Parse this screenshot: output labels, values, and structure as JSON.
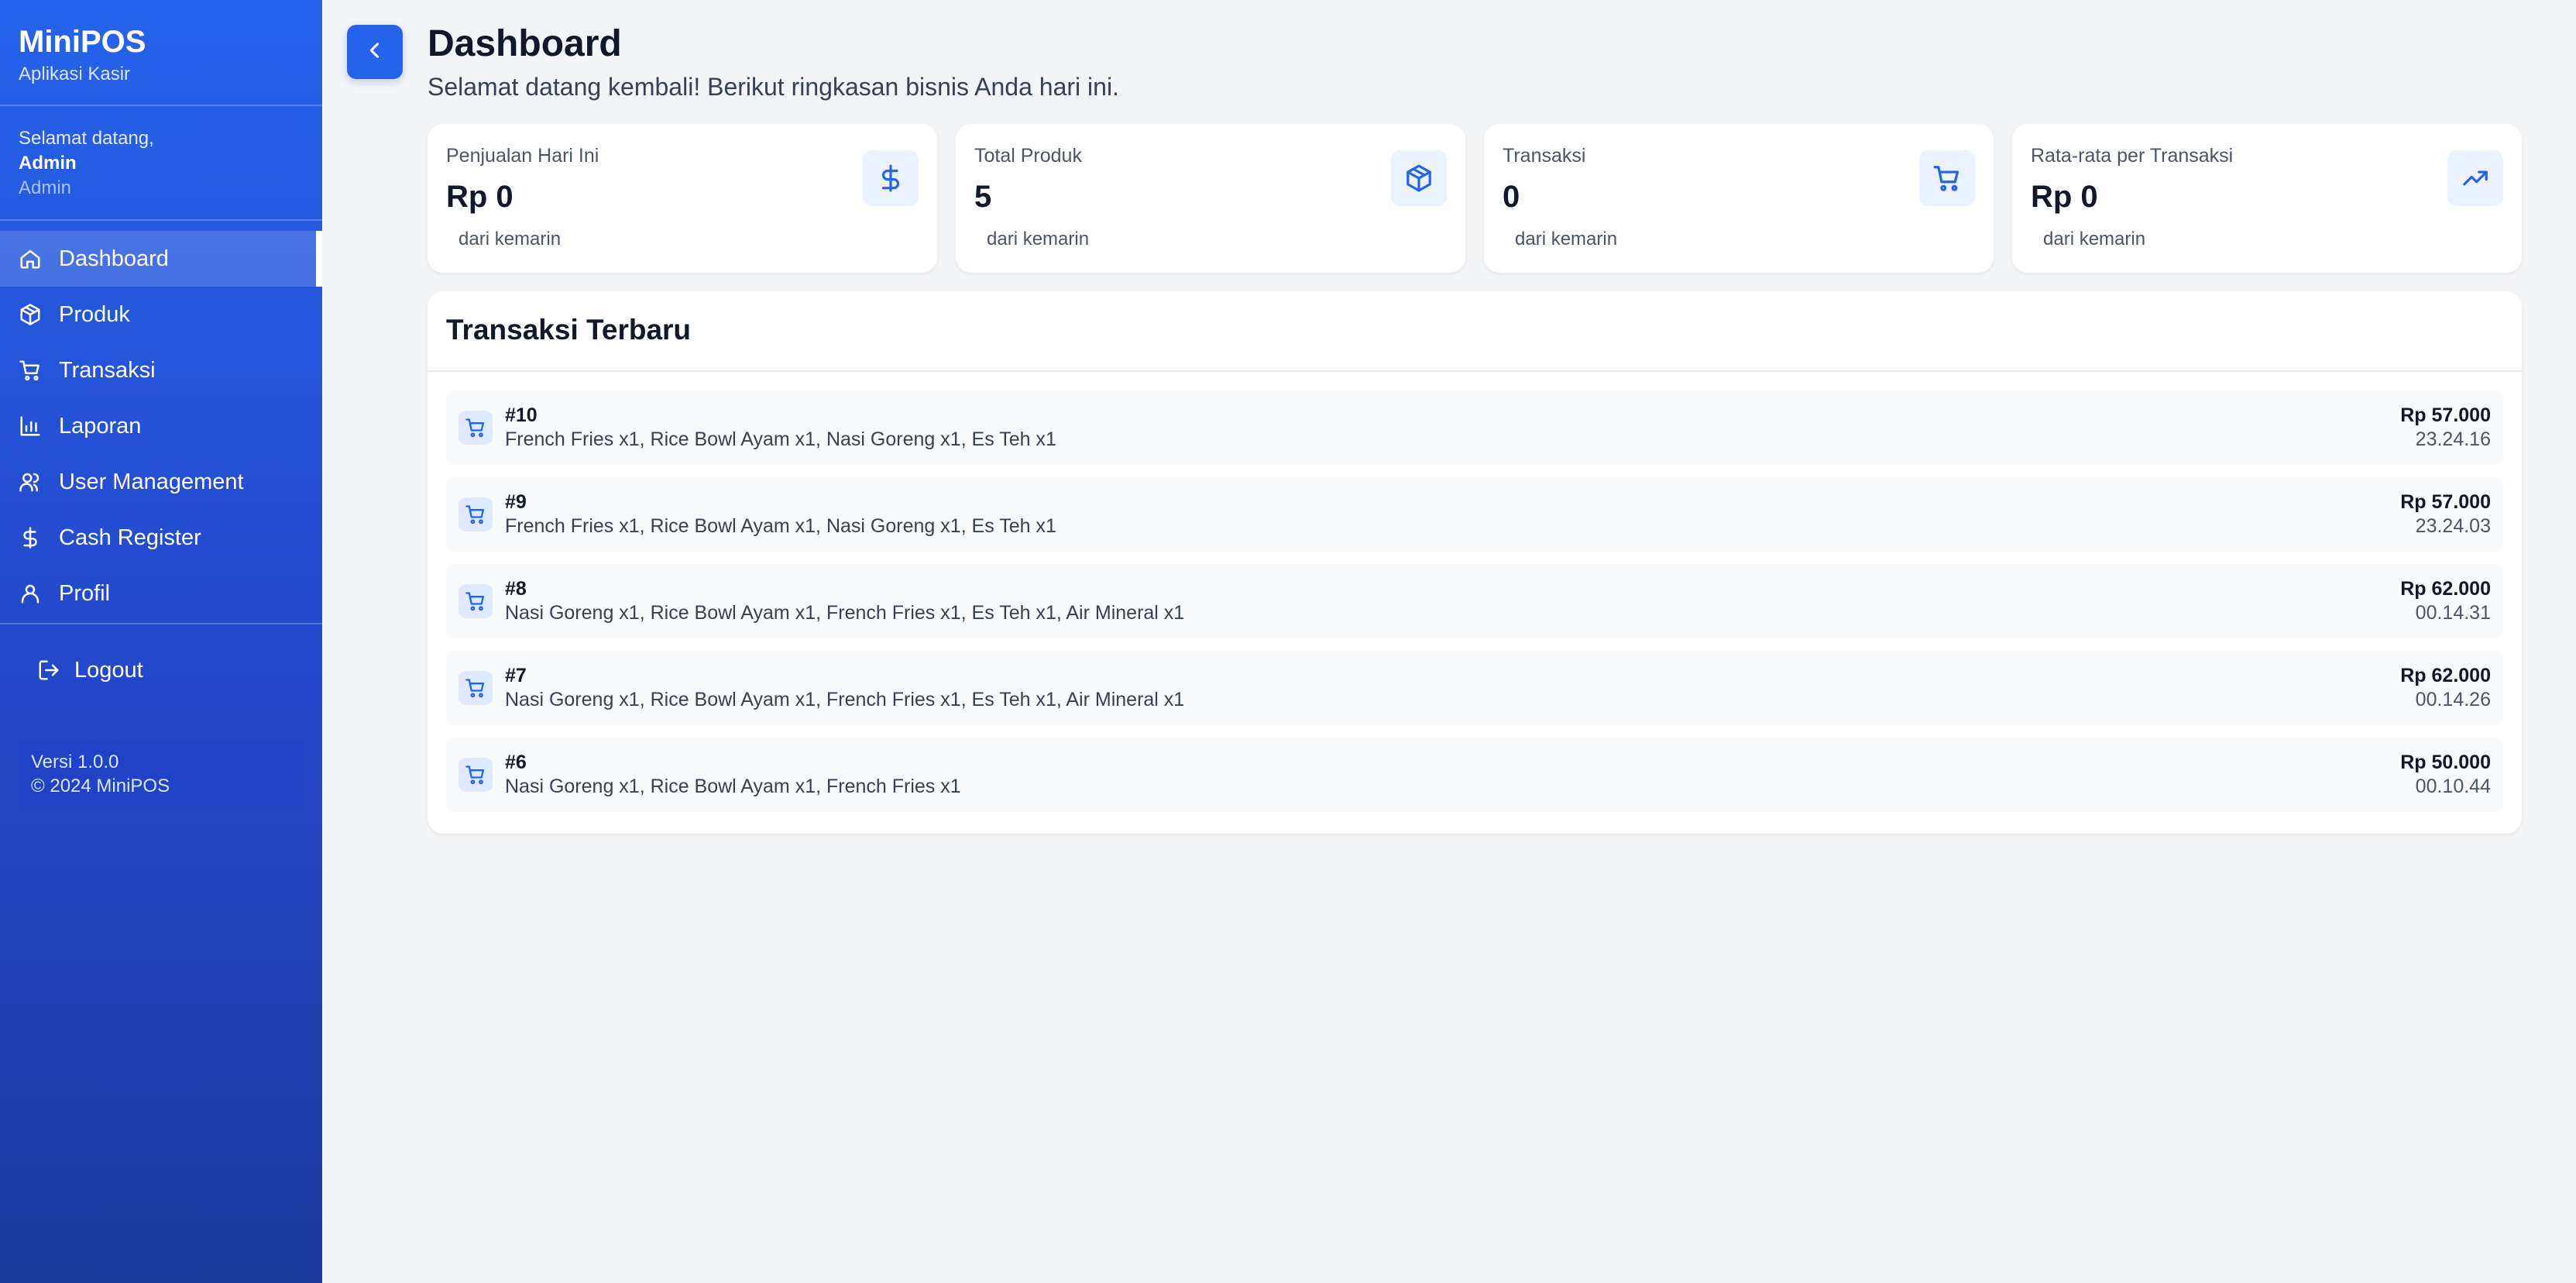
{
  "brand": {
    "title": "MiniPOS",
    "subtitle": "Aplikasi Kasir"
  },
  "user": {
    "greeting": "Selamat datang,",
    "name": "Admin",
    "role": "Admin"
  },
  "nav": {
    "items": [
      {
        "label": "Dashboard",
        "icon": "home-icon"
      },
      {
        "label": "Produk",
        "icon": "box-icon"
      },
      {
        "label": "Transaksi",
        "icon": "cart-icon"
      },
      {
        "label": "Laporan",
        "icon": "bar-chart-icon"
      },
      {
        "label": "User Management",
        "icon": "users-icon"
      },
      {
        "label": "Cash Register",
        "icon": "dollar-icon"
      },
      {
        "label": "Profil",
        "icon": "user-icon"
      }
    ],
    "active": "Dashboard",
    "logout_label": "Logout"
  },
  "version": {
    "line1": "Versi 1.0.0",
    "line2": "© 2024 MiniPOS"
  },
  "header": {
    "title": "Dashboard",
    "subtitle": "Selamat datang kembali! Berikut ringkasan bisnis Anda hari ini."
  },
  "stats": [
    {
      "label": "Penjualan Hari Ini",
      "value": "Rp 0",
      "note": "dari kemarin",
      "icon": "dollar-icon"
    },
    {
      "label": "Total Produk",
      "value": "5",
      "note": "dari kemarin",
      "icon": "box-icon"
    },
    {
      "label": "Transaksi",
      "value": "0",
      "note": "dari kemarin",
      "icon": "cart-icon"
    },
    {
      "label": "Rata-rata per Transaksi",
      "value": "Rp 0",
      "note": "dari kemarin",
      "icon": "trending-up-icon"
    }
  ],
  "recent": {
    "title": "Transaksi Terbaru",
    "rows": [
      {
        "id": "#10",
        "items": "French Fries x1, Rice Bowl Ayam x1, Nasi Goreng x1, Es Teh x1",
        "amount": "Rp 57.000",
        "time": "23.24.16"
      },
      {
        "id": "#9",
        "items": "French Fries x1, Rice Bowl Ayam x1, Nasi Goreng x1, Es Teh x1",
        "amount": "Rp 57.000",
        "time": "23.24.03"
      },
      {
        "id": "#8",
        "items": "Nasi Goreng x1, Rice Bowl Ayam x1, French Fries x1, Es Teh x1, Air Mineral x1",
        "amount": "Rp 62.000",
        "time": "00.14.31"
      },
      {
        "id": "#7",
        "items": "Nasi Goreng x1, Rice Bowl Ayam x1, French Fries x1, Es Teh x1, Air Mineral x1",
        "amount": "Rp 62.000",
        "time": "00.14.26"
      },
      {
        "id": "#6",
        "items": "Nasi Goreng x1, Rice Bowl Ayam x1, French Fries x1",
        "amount": "Rp 50.000",
        "time": "00.10.44"
      }
    ]
  },
  "colors": {
    "primary": "#2563eb",
    "sidebar_end": "#1e3a9e",
    "background": "#f3f4f6",
    "icon_tint": "#eaf1ff"
  }
}
